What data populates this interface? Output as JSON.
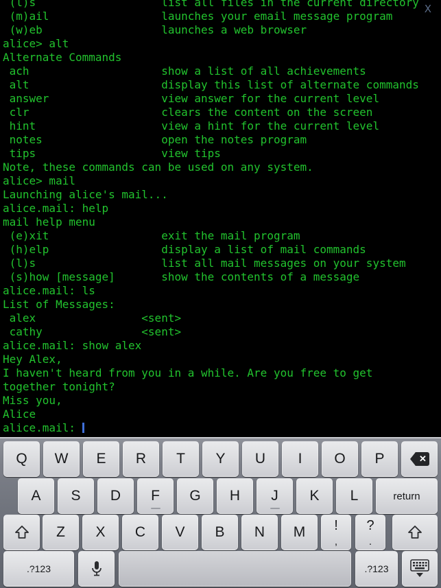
{
  "screen": {
    "text_color": "#22c32e",
    "background_color": "#000000",
    "cursor_color": "#3f6fd8"
  },
  "close_button": {
    "label": "X"
  },
  "terminal": {
    "lines": [
      " (l)s                   list all files in the current directory",
      " (m)ail                 launches your email message program",
      " (w)eb                  launches a web browser",
      "alice> alt",
      "Alternate Commands",
      " ach                    show a list of all achievements",
      " alt                    display this list of alternate commands",
      " answer                 view answer for the current level",
      " clr                    clears the content on the screen",
      " hint                   view a hint for the current level",
      " notes                  open the notes program",
      " tips                   view tips",
      "Note, these commands can be used on any system.",
      "alice> mail",
      "Launching alice's mail...",
      "alice.mail: help",
      "mail help menu",
      " (e)xit                 exit the mail program",
      " (h)elp                 display a list of mail commands",
      " (l)s                   list all mail messages on your system",
      " (s)how [message]       show the contents of a message",
      "alice.mail: ls",
      "List of Messages:",
      " alex                <sent>",
      " cathy               <sent>",
      "alice.mail: show alex",
      "Hey Alex,",
      "I haven't heard from you in a while. Are you free to get",
      "together tonight?",
      "Miss you,",
      "Alice"
    ],
    "prompt": "alice.mail: ",
    "input_value": ""
  },
  "keyboard": {
    "row1": [
      {
        "label": "Q",
        "name": "key-q"
      },
      {
        "label": "W",
        "name": "key-w"
      },
      {
        "label": "E",
        "name": "key-e"
      },
      {
        "label": "R",
        "name": "key-r"
      },
      {
        "label": "T",
        "name": "key-t"
      },
      {
        "label": "Y",
        "name": "key-y"
      },
      {
        "label": "U",
        "name": "key-u"
      },
      {
        "label": "I",
        "name": "key-i"
      },
      {
        "label": "O",
        "name": "key-o"
      },
      {
        "label": "P",
        "name": "key-p"
      }
    ],
    "row2": [
      {
        "label": "A",
        "name": "key-a"
      },
      {
        "label": "S",
        "name": "key-s"
      },
      {
        "label": "D",
        "name": "key-d"
      },
      {
        "label": "F",
        "name": "key-f"
      },
      {
        "label": "G",
        "name": "key-g"
      },
      {
        "label": "H",
        "name": "key-h"
      },
      {
        "label": "J",
        "name": "key-j"
      },
      {
        "label": "K",
        "name": "key-k"
      },
      {
        "label": "L",
        "name": "key-l"
      }
    ],
    "row3": [
      {
        "label": "Z",
        "name": "key-z"
      },
      {
        "label": "X",
        "name": "key-x"
      },
      {
        "label": "C",
        "name": "key-c"
      },
      {
        "label": "V",
        "name": "key-v"
      },
      {
        "label": "B",
        "name": "key-b"
      },
      {
        "label": "N",
        "name": "key-n"
      },
      {
        "label": "M",
        "name": "key-m"
      }
    ],
    "backspace": {
      "icon": "backspace-icon"
    },
    "return_key": {
      "label": "return"
    },
    "shift_left": {
      "icon": "shift-icon"
    },
    "shift_right": {
      "icon": "shift-icon"
    },
    "punct_excl": {
      "top": "!",
      "bottom": ","
    },
    "punct_ques": {
      "top": "?",
      "bottom": "."
    },
    "numeric_left": {
      "label": ".?123"
    },
    "numeric_right": {
      "label": ".?123"
    },
    "mic": {
      "icon": "microphone-icon"
    },
    "space": {
      "label": ""
    },
    "dismiss": {
      "icon": "dismiss-keyboard-icon"
    }
  }
}
